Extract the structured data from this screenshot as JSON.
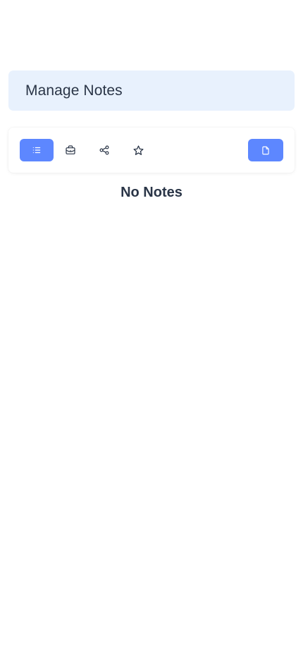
{
  "header": {
    "title": "Manage Notes"
  },
  "toolbar": {
    "filters": [
      {
        "icon": "list-icon",
        "active": true
      },
      {
        "icon": "briefcase-icon",
        "active": false
      },
      {
        "icon": "share-icon",
        "active": false
      },
      {
        "icon": "star-icon",
        "active": false
      }
    ],
    "add_note_icon": "file-icon"
  },
  "main": {
    "empty_message": "No Notes"
  },
  "colors": {
    "accent": "#5d87ff",
    "header_bg": "#e8f1fd",
    "text": "#2a3547"
  }
}
